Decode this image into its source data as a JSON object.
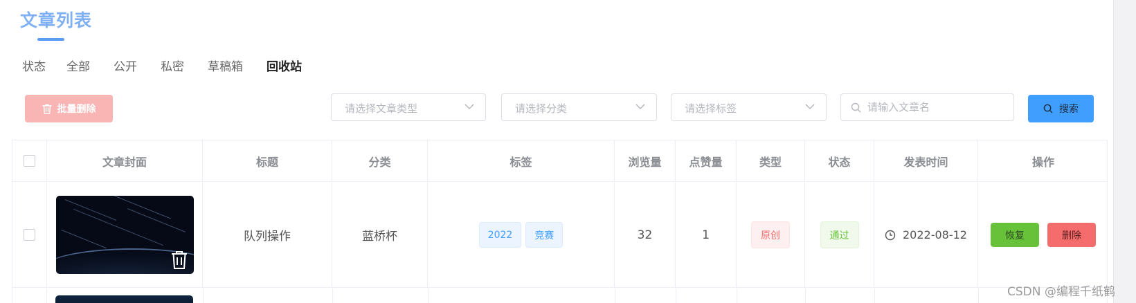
{
  "page": {
    "title": "文章列表"
  },
  "status_filter": {
    "label": "状态",
    "items": [
      {
        "label": "全部",
        "active": false
      },
      {
        "label": "公开",
        "active": false
      },
      {
        "label": "私密",
        "active": false
      },
      {
        "label": "草稿箱",
        "active": false
      },
      {
        "label": "回收站",
        "active": true
      }
    ]
  },
  "toolbar": {
    "batch_delete_label": "批量删除",
    "type_select_placeholder": "请选择文章类型",
    "category_select_placeholder": "请选择分类",
    "tag_select_placeholder": "请选择标签",
    "search_placeholder": "请输入文章名",
    "search_button_label": "搜索"
  },
  "table": {
    "columns": [
      "文章封面",
      "标题",
      "分类",
      "标签",
      "浏览量",
      "点赞量",
      "类型",
      "状态",
      "发表时间",
      "操作"
    ],
    "rows": [
      {
        "title": "队列操作",
        "category": "蓝桥杯",
        "tags": [
          "2022",
          "竞赛"
        ],
        "views": "32",
        "likes": "1",
        "type": "原创",
        "status": "通过",
        "publish_time": "2022-08-12",
        "actions": {
          "restore": "恢复",
          "delete": "删除"
        }
      }
    ]
  },
  "watermark": "CSDN @编程千纸鹤",
  "colors": {
    "accent": "#409eff",
    "title": "#7fb0f4",
    "danger": "#f56c6c",
    "success": "#67c23a",
    "batch_delete_bg": "#f9b4b4"
  },
  "icons": {
    "batch_delete": "trash-icon",
    "select": "chevron-down-icon",
    "search": "search-icon",
    "time": "clock-icon",
    "cover_delete": "trash-icon"
  }
}
